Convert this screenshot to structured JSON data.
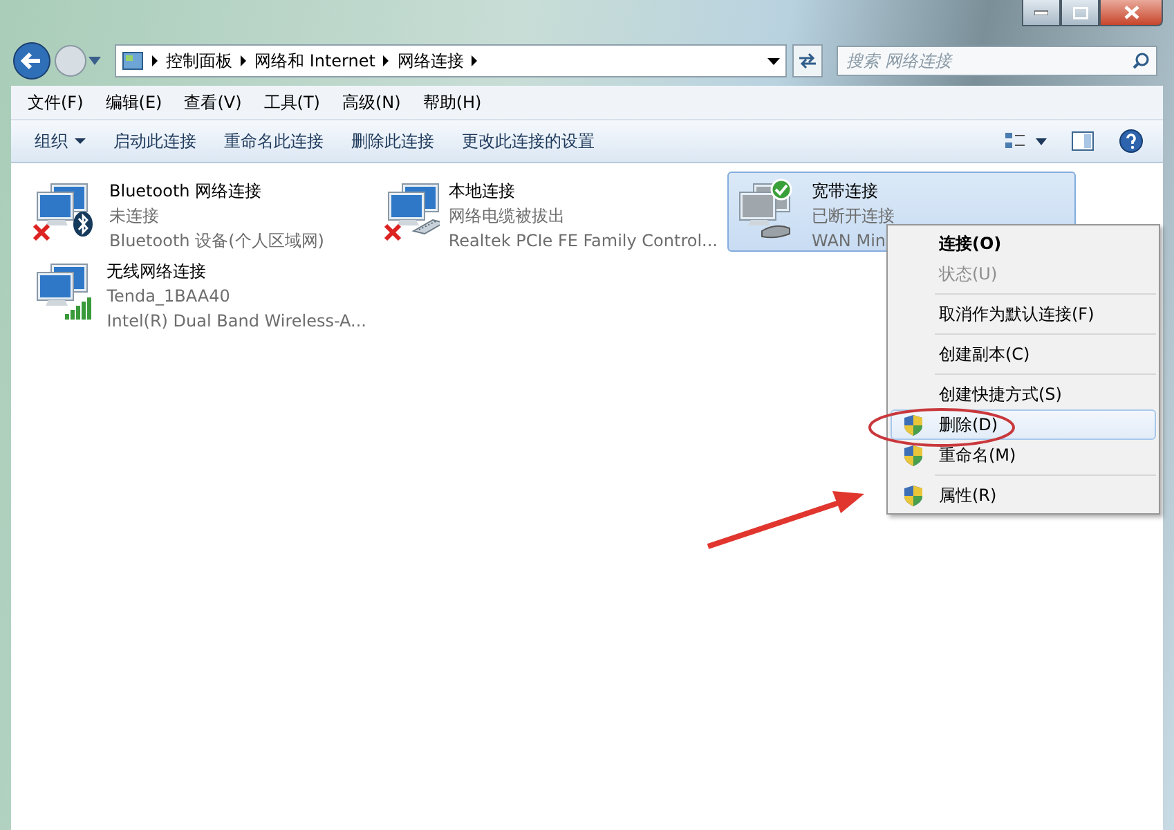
{
  "address_bar": {
    "breadcrumbs": [
      "控制面板",
      "网络和 Internet",
      "网络连接"
    ]
  },
  "search": {
    "placeholder": "搜索 网络连接"
  },
  "menu_bar": [
    "文件(F)",
    "编辑(E)",
    "查看(V)",
    "工具(T)",
    "高级(N)",
    "帮助(H)"
  ],
  "command_bar": [
    {
      "label": "组织",
      "dropdown": true
    },
    {
      "label": "启动此连接",
      "dropdown": false
    },
    {
      "label": "重命名此连接",
      "dropdown": false
    },
    {
      "label": "删除此连接",
      "dropdown": false
    },
    {
      "label": "更改此连接的设置",
      "dropdown": false
    }
  ],
  "connections": [
    {
      "name": "Bluetooth 网络连接",
      "status": "未连接",
      "device": "Bluetooth 设备(个人区域网)",
      "error": true,
      "default": false,
      "kind": "bluetooth",
      "selected": false
    },
    {
      "name": "本地连接",
      "status": "网络电缆被拔出",
      "device": "Realtek PCIe FE Family Control...",
      "error": true,
      "default": false,
      "kind": "ethernet",
      "selected": false
    },
    {
      "name": "宽带连接",
      "status": "已断开连接",
      "device": "WAN Min",
      "error": false,
      "default": true,
      "kind": "modem",
      "selected": true
    },
    {
      "name": "无线网络连接",
      "status": "Tenda_1BAA40",
      "device": "Intel(R) Dual Band Wireless-A...",
      "error": false,
      "default": false,
      "kind": "wifi",
      "selected": false
    }
  ],
  "context_menu": [
    {
      "kind": "item",
      "label": "连接(O)",
      "default": true,
      "disabled": false,
      "selected": false,
      "shield": false
    },
    {
      "kind": "item",
      "label": "状态(U)",
      "default": false,
      "disabled": true,
      "selected": false,
      "shield": false
    },
    {
      "kind": "separator"
    },
    {
      "kind": "item",
      "label": "取消作为默认连接(F)",
      "default": false,
      "disabled": false,
      "selected": false,
      "shield": false
    },
    {
      "kind": "separator"
    },
    {
      "kind": "item",
      "label": "创建副本(C)",
      "default": false,
      "disabled": false,
      "selected": false,
      "shield": false
    },
    {
      "kind": "separator"
    },
    {
      "kind": "item",
      "label": "创建快捷方式(S)",
      "default": false,
      "disabled": false,
      "selected": false,
      "shield": false
    },
    {
      "kind": "item",
      "label": "删除(D)",
      "default": false,
      "disabled": false,
      "selected": true,
      "shield": true
    },
    {
      "kind": "item",
      "label": "重命名(M)",
      "default": false,
      "disabled": false,
      "selected": false,
      "shield": true
    },
    {
      "kind": "separator"
    },
    {
      "kind": "item",
      "label": "属性(R)",
      "default": false,
      "disabled": false,
      "selected": false,
      "shield": true
    }
  ]
}
